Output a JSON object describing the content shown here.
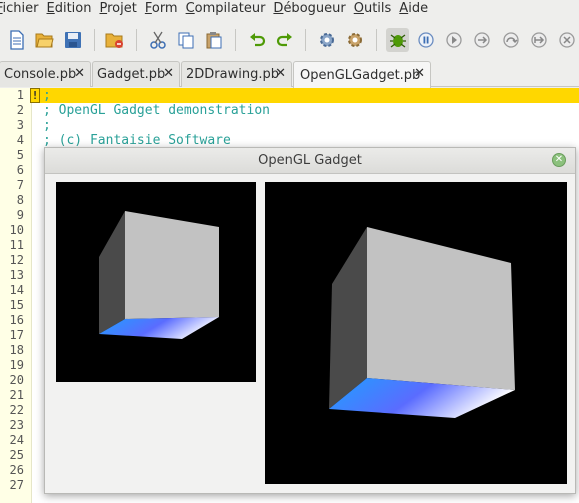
{
  "menu": [
    {
      "mnemonic": "F",
      "rest": "ichier"
    },
    {
      "mnemonic": "E",
      "rest": "dition"
    },
    {
      "mnemonic": "P",
      "rest": "rojet"
    },
    {
      "mnemonic": "F",
      "rest": "orm"
    },
    {
      "mnemonic": "C",
      "rest": "ompilateur"
    },
    {
      "mnemonic": "D",
      "rest": "ébogueur"
    },
    {
      "mnemonic": "O",
      "rest": "utils"
    },
    {
      "mnemonic": "A",
      "rest": "ide"
    }
  ],
  "tabs": [
    {
      "label": "Console.pb",
      "close": "✕"
    },
    {
      "label": "Gadget.pb",
      "close": "✕"
    },
    {
      "label": "2DDrawing.pb",
      "close": "✕"
    },
    {
      "label": "OpenGLGadget.pb",
      "close": "✕"
    }
  ],
  "editor": {
    "line_numbers": [
      "1",
      "2",
      "3",
      "4",
      "5",
      "6",
      "7",
      "8",
      "9",
      "10",
      "11",
      "12",
      "13",
      "14",
      "15",
      "16",
      "17",
      "18",
      "19",
      "20",
      "21",
      "22",
      "23",
      "24",
      "25",
      "26",
      "27"
    ],
    "current_line_marker": "!",
    "lines": [
      ";",
      "; OpenGL Gadget demonstration",
      ";",
      "; (c) Fantaisie Software"
    ]
  },
  "dialog": {
    "title": "OpenGL Gadget",
    "close_symbol": "✕"
  },
  "icons": [
    "new-file-icon",
    "open-file-icon",
    "save-icon",
    "close-file-icon",
    "cut-icon",
    "copy-icon",
    "paste-icon",
    "undo-icon",
    "redo-icon",
    "compile-icon",
    "build-icon",
    "debugger-icon",
    "pause-icon",
    "stop-icon",
    "step-icon",
    "step-over-icon",
    "step-out-icon",
    "kill-icon"
  ],
  "colors": {
    "current_line": "#ffd700",
    "comment": "#2aa198",
    "gutter": "#ffffe6"
  }
}
